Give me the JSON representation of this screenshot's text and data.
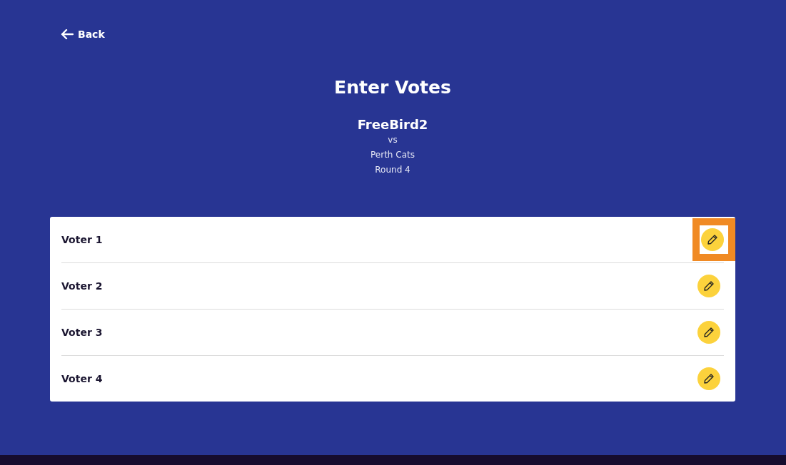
{
  "back": {
    "label": "Back"
  },
  "title": "Enter Votes",
  "match": {
    "team": "FreeBird2",
    "vs": "vs",
    "opponent": "Perth Cats",
    "round": "Round 4"
  },
  "voters": [
    {
      "name": "Voter 1",
      "selected": true
    },
    {
      "name": "Voter 2",
      "selected": false
    },
    {
      "name": "Voter 3",
      "selected": false
    },
    {
      "name": "Voter 4",
      "selected": false
    }
  ]
}
